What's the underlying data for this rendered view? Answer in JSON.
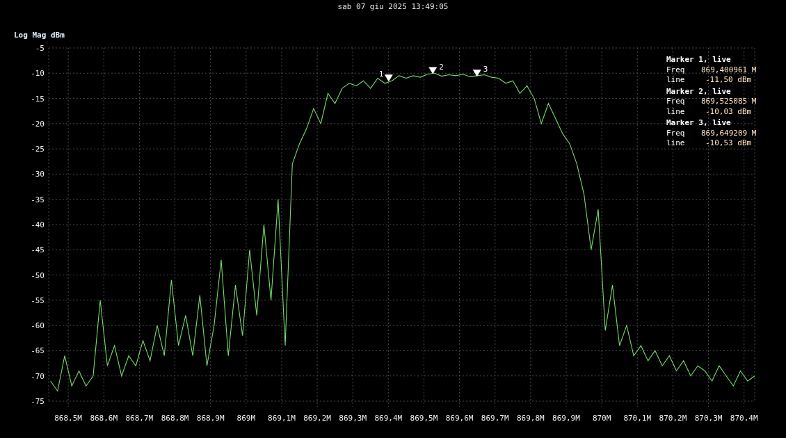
{
  "title": "sab 07 giu 2025 13:49:05",
  "chart_data": {
    "type": "line",
    "grid": true,
    "ylabel": "Log Mag dBm",
    "xlim": [
      868.445,
      870.43
    ],
    "ylim": [
      -75,
      -5
    ],
    "yticks": [
      -5,
      -10,
      -15,
      -20,
      -25,
      -30,
      -35,
      -40,
      -45,
      -50,
      -55,
      -60,
      -65,
      -70,
      -75
    ],
    "xticks": [
      {
        "value": 868.5,
        "label": "868,5M"
      },
      {
        "value": 868.6,
        "label": "868,6M"
      },
      {
        "value": 868.7,
        "label": "868,7M"
      },
      {
        "value": 868.8,
        "label": "868,8M"
      },
      {
        "value": 868.9,
        "label": "868,9M"
      },
      {
        "value": 869.0,
        "label": "869M"
      },
      {
        "value": 869.1,
        "label": "869,1M"
      },
      {
        "value": 869.2,
        "label": "869,2M"
      },
      {
        "value": 869.3,
        "label": "869,3M"
      },
      {
        "value": 869.4,
        "label": "869,4M"
      },
      {
        "value": 869.5,
        "label": "869,5M"
      },
      {
        "value": 869.6,
        "label": "869,6M"
      },
      {
        "value": 869.7,
        "label": "869,7M"
      },
      {
        "value": 869.8,
        "label": "869,8M"
      },
      {
        "value": 869.9,
        "label": "869,9M"
      },
      {
        "value": 870.0,
        "label": "870M"
      },
      {
        "value": 870.1,
        "label": "870,1M"
      },
      {
        "value": 870.2,
        "label": "870,2M"
      },
      {
        "value": 870.3,
        "label": "870,3M"
      },
      {
        "value": 870.4,
        "label": "870,4M"
      }
    ],
    "x": [
      868.45,
      868.47,
      868.49,
      868.51,
      868.53,
      868.55,
      868.57,
      868.59,
      868.61,
      868.63,
      868.65,
      868.67,
      868.69,
      868.71,
      868.73,
      868.75,
      868.77,
      868.79,
      868.81,
      868.83,
      868.85,
      868.87,
      868.89,
      868.91,
      868.93,
      868.95,
      868.97,
      868.99,
      869.01,
      869.03,
      869.05,
      869.07,
      869.09,
      869.11,
      869.13,
      869.15,
      869.17,
      869.19,
      869.21,
      869.23,
      869.25,
      869.27,
      869.29,
      869.31,
      869.33,
      869.35,
      869.37,
      869.39,
      869.41,
      869.43,
      869.45,
      869.47,
      869.49,
      869.51,
      869.53,
      869.55,
      869.57,
      869.59,
      869.61,
      869.63,
      869.65,
      869.67,
      869.69,
      869.71,
      869.73,
      869.75,
      869.77,
      869.79,
      869.81,
      869.83,
      869.85,
      869.87,
      869.89,
      869.91,
      869.93,
      869.95,
      869.97,
      869.99,
      870.01,
      870.03,
      870.05,
      870.07,
      870.09,
      870.11,
      870.13,
      870.15,
      870.17,
      870.19,
      870.21,
      870.23,
      870.25,
      870.27,
      870.29,
      870.31,
      870.33,
      870.35,
      870.37,
      870.39,
      870.41,
      870.43
    ],
    "series": [
      {
        "color": "#74dc6a",
        "values": [
          -71,
          -73,
          -66,
          -72,
          -69,
          -72,
          -70,
          -55,
          -68,
          -64,
          -70,
          -66,
          -68,
          -63,
          -67,
          -60,
          -66,
          -51,
          -64,
          -58,
          -66,
          -54,
          -68,
          -60,
          -47,
          -66,
          -52,
          -62,
          -45,
          -58,
          -40,
          -55,
          -35,
          -64,
          -28,
          -24,
          -21,
          -17,
          -20,
          -14,
          -16,
          -13,
          -12,
          -12.5,
          -11.5,
          -13,
          -11,
          -12,
          -11.5,
          -10.5,
          -11,
          -10.5,
          -10.8,
          -10.2,
          -10,
          -10.6,
          -10.3,
          -10.5,
          -10.2,
          -10.7,
          -10.5,
          -10.3,
          -10.8,
          -11,
          -12,
          -11.5,
          -14,
          -12.5,
          -15,
          -20,
          -16,
          -19,
          -22,
          -24,
          -28,
          -34,
          -45,
          -37,
          -61,
          -52,
          -64,
          -60,
          -66,
          -64,
          -67,
          -65,
          -68,
          -66,
          -69,
          -67,
          -70,
          -68,
          -69,
          -71,
          -68,
          -70,
          -72,
          -69,
          -71,
          -70
        ]
      }
    ]
  },
  "markers": [
    {
      "label": "1",
      "heading": "Marker 1, live",
      "freq_label": "Freq",
      "freq": "869,400961 M",
      "level_label": "line",
      "level_value": "-11,50 dBm"
    },
    {
      "label": "2",
      "heading": "Marker 2, live",
      "freq_label": "Freq",
      "freq": "869,525085 M",
      "level_label": "line",
      "level_value": "-10,03 dBm"
    },
    {
      "label": "3",
      "heading": "Marker 3, live",
      "freq_label": "Freq",
      "freq": "869,649209 M",
      "level_label": "line",
      "level_value": "-10,53 dBm"
    }
  ]
}
